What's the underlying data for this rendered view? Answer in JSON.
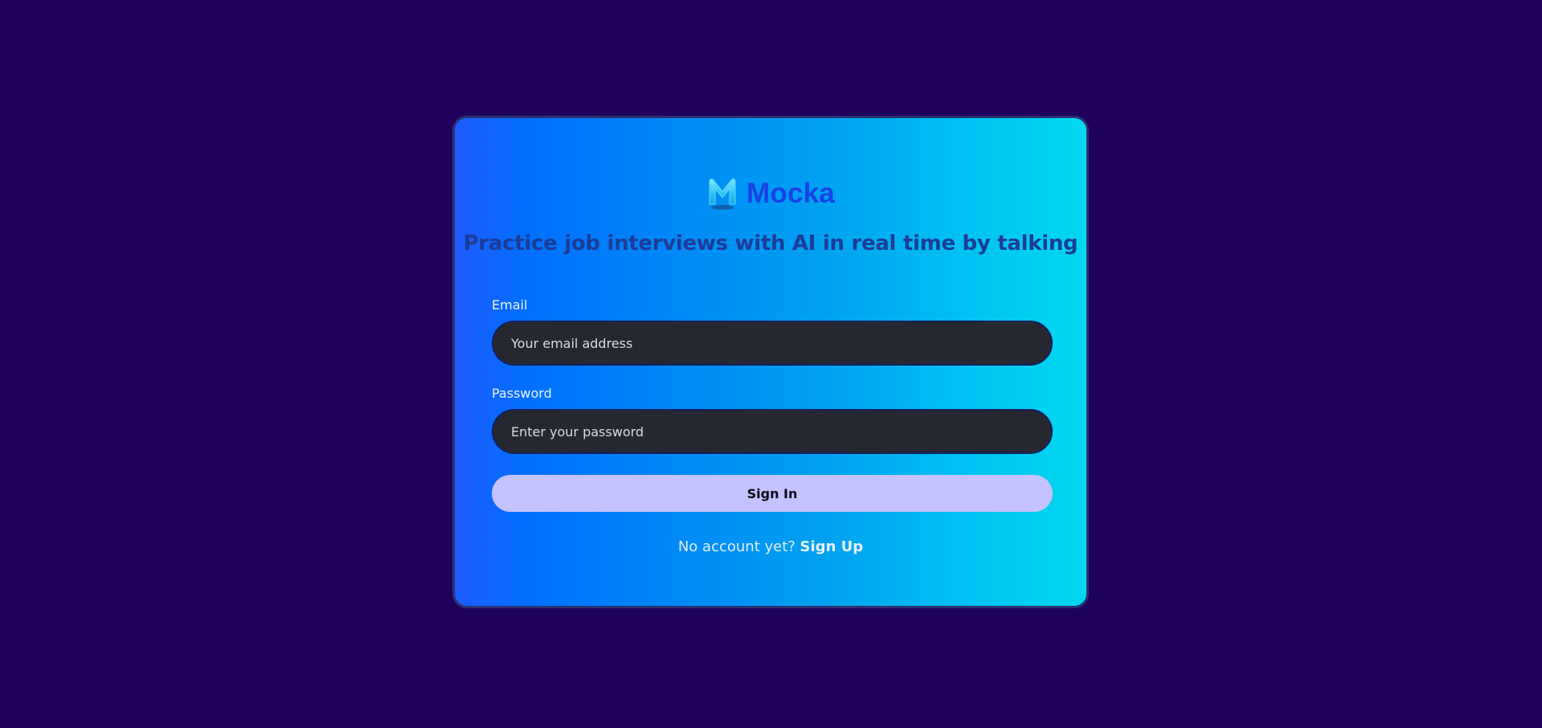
{
  "brand": {
    "name": "Mocka",
    "logo_icon": "m-logo-icon"
  },
  "tagline": "Practice job interviews with AI in real time by talking",
  "form": {
    "email_label": "Email",
    "email_placeholder": "Your email address",
    "email_value": "",
    "password_label": "Password",
    "password_placeholder": "Enter your password",
    "password_value": "",
    "submit_label": "Sign In"
  },
  "footer": {
    "prompt": "No account yet?",
    "signup_label": "Sign Up"
  },
  "colors": {
    "page_background": "#1f005c",
    "brand_text": "#1743e6",
    "button_background": "#c4c2ff",
    "input_background": "#252830"
  }
}
